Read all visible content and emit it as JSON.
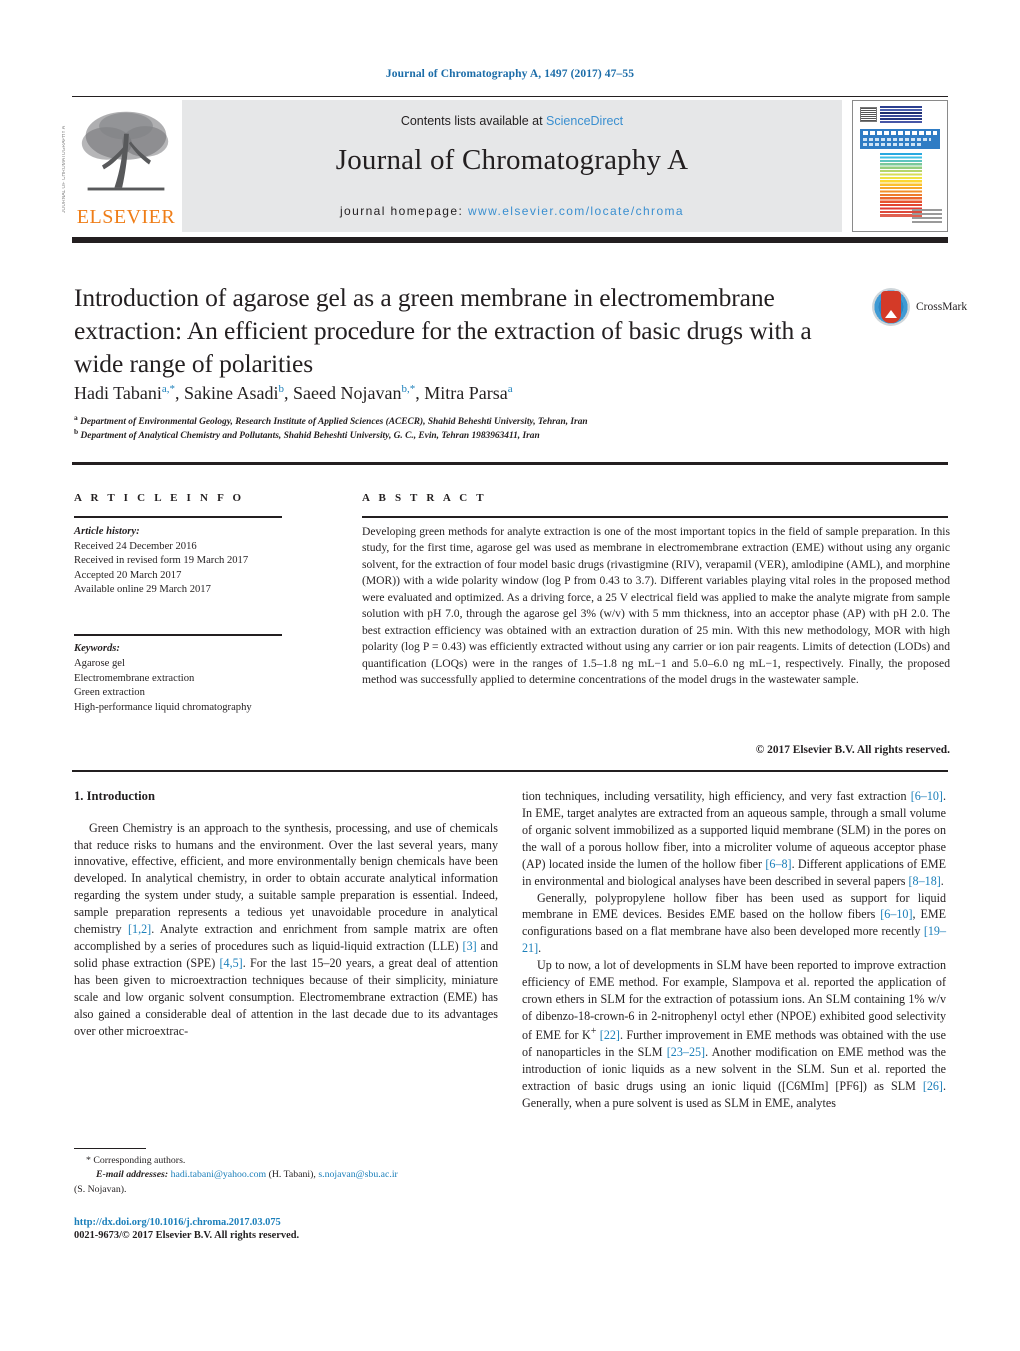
{
  "running_head": "Journal of Chromatography A, 1497 (2017) 47–55",
  "masthead": {
    "publisher_name": "ELSEVIER",
    "contents_prefix": "Contents lists available at ",
    "contents_link": "ScienceDirect",
    "journal_title": "Journal of Chromatography A",
    "homepage_prefix": "journal homepage: ",
    "homepage_url": "www.elsevier.com/locate/chroma",
    "cover_band_title": "JOURNAL OF CHROMATOGRAPHY A",
    "side_strip": "JOURNAL OF CHROMATOGRAPHY A"
  },
  "article": {
    "title": "Introduction of agarose gel as a green membrane in electromembrane extraction: An efficient procedure for the extraction of basic drugs with a wide range of polarities",
    "crossmark_label": "CrossMark",
    "authors_html": "Hadi Tabani<sup>a,*</sup>, Sakine Asadi<sup>b</sup>, Saeed Nojavan<sup>b,*</sup>, Mitra Parsa<sup>a</sup>",
    "affiliation_a": "Department of Environmental Geology, Research Institute of Applied Sciences (ACECR), Shahid Beheshti University, Tehran, Iran",
    "affiliation_b": "Department of Analytical Chemistry and Pollutants, Shahid Beheshti University, G. C., Evin, Tehran 1983963411, Iran"
  },
  "article_info": {
    "heading": "A R T I C L E    I N F O",
    "history_label": "Article history:",
    "history": [
      "Received 24 December 2016",
      "Received in revised form 19 March 2017",
      "Accepted 20 March 2017",
      "Available online 29 March 2017"
    ],
    "keywords_label": "Keywords:",
    "keywords": [
      "Agarose gel",
      "Electromembrane extraction",
      "Green extraction",
      "High-performance liquid chromatography"
    ]
  },
  "abstract": {
    "heading": "A B S T R A C T",
    "text": "Developing green methods for analyte extraction is one of the most important topics in the field of sample preparation. In this study, for the first time, agarose gel was used as membrane in electromembrane extraction (EME) without using any organic solvent, for the extraction of four model basic drugs (rivastigmine (RIV), verapamil (VER), amlodipine (AML), and morphine (MOR)) with a wide polarity window (log P from 0.43 to 3.7). Different variables playing vital roles in the proposed method were evaluated and optimized. As a driving force, a 25 V electrical field was applied to make the analyte migrate from sample solution with pH 7.0, through the agarose gel 3% (w/v) with 5 mm thickness, into an acceptor phase (AP) with pH 2.0. The best extraction efficiency was obtained with an extraction duration of 25 min. With this new methodology, MOR with high polarity (log P = 0.43) was efficiently extracted without using any carrier or ion pair reagents. Limits of detection (LODs) and quantification (LOQs) were in the ranges of 1.5–1.8 ng mL−1 and 5.0–6.0 ng mL−1, respectively. Finally, the proposed method was successfully applied to determine concentrations of the model drugs in the wastewater sample.",
    "copyright": "© 2017 Elsevier B.V. All rights reserved."
  },
  "body": {
    "section_number_title": "1.  Introduction",
    "left_paragraph_1": "Green Chemistry is an approach to the synthesis, processing, and use of chemicals that reduce risks to humans and the environment. Over the last several years, many innovative, effective, efficient, and more environmentally benign chemicals have been developed. In analytical chemistry, in order to obtain accurate analytical information regarding the system under study, a suitable sample preparation is essential. Indeed, sample preparation represents a tedious yet unavoidable procedure in analytical chemistry ",
    "ref_1_2": "[1,2]",
    "left_part_2": ". Analyte extraction and enrichment from sample matrix are often accomplished by a series of procedures such as liquid-liquid extraction (LLE) ",
    "ref_3": "[3]",
    "left_part_3": " and solid phase extraction (SPE) ",
    "ref_4_5": "[4,5]",
    "left_part_4": ". For the last 15–20 years, a great deal of attention has been given to microextraction techniques because of their simplicity, miniature scale and low organic solvent consumption. Electromembrane extraction (EME) has also gained a considerable deal of attention in the last decade due to its advantages over other microextrac-",
    "right_part_1": "tion techniques, including versatility, high efficiency, and very fast extraction ",
    "ref_6_10a": "[6–10]",
    "right_part_2": ". In EME, target analytes are extracted from an aqueous sample, through a small volume of organic solvent immobilized as a supported liquid membrane (SLM) in the pores on the wall of a porous hollow fiber, into a microliter volume of aqueous acceptor phase (AP) located inside the lumen of the hollow fiber ",
    "ref_6_8": "[6–8]",
    "right_part_3": ". Different applications of EME in environmental and biological analyses have been described in several papers ",
    "ref_8_18": "[8–18]",
    "right_part_4": ".",
    "right_paragraph_2a": "Generally, polypropylene hollow fiber has been used as support for liquid membrane in EME devices. Besides EME based on the hollow fibers ",
    "ref_6_10b": "[6–10]",
    "right_paragraph_2b": ", EME configurations based on a flat membrane have also been developed more recently ",
    "ref_19_21": "[19–21]",
    "right_paragraph_2c": ".",
    "right_paragraph_3a": "Up to now, a lot of developments in SLM have been reported to improve extraction efficiency of EME method. For example, Slampova et al. reported the application of crown ethers in SLM for the extraction of potassium ions. An SLM containing 1% w/v of dibenzo-18-crown-6 in 2-nitrophenyl octyl ether (NPOE) exhibited good selectivity of EME for K",
    "k_sup": "+",
    "ref_22": "[22]",
    "right_paragraph_3b": ". Further improvement in EME methods was obtained with the use of nanoparticles in the SLM ",
    "ref_23_25": "[23–25]",
    "right_paragraph_3c": ". Another modification on EME method was the introduction of ionic liquids as a new solvent in the SLM. Sun et al. reported the extraction of basic drugs using an ionic liquid ([C6MIm] [PF6]) as SLM ",
    "ref_26": "[26]",
    "right_paragraph_3d": ". Generally, when a pure solvent is used as SLM in EME, analytes"
  },
  "footer": {
    "corresponding_marker": "*",
    "corresponding_text": "Corresponding authors.",
    "email_label": "E-mail addresses:",
    "email_1": "hadi.tabani@yahoo.com",
    "email_1_owner": "(H. Tabani),",
    "email_2": "s.nojavan@sbu.ac.ir",
    "email_2_owner": "(S. Nojavan).",
    "doi": "http://dx.doi.org/10.1016/j.chroma.2017.03.075",
    "issn_line": "0021-9673/© 2017 Elsevier B.V. All rights reserved."
  },
  "colors": {
    "link": "#1b7fba",
    "elsevier_orange": "#ef7d17",
    "banner_gray": "#e6e7e8",
    "rule_black": "#231f20"
  }
}
